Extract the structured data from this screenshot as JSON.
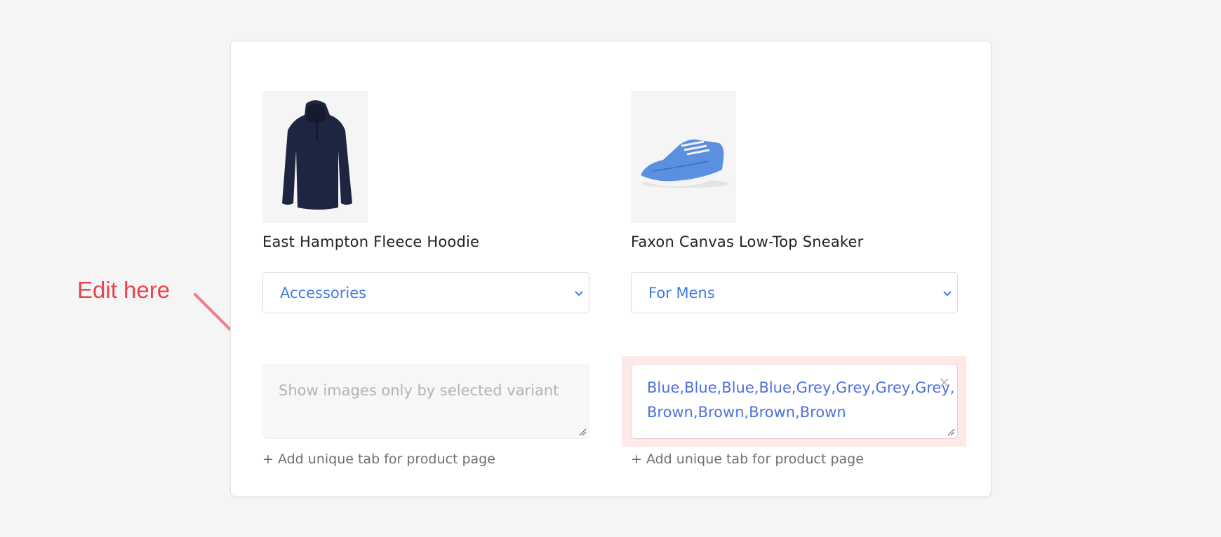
{
  "annotation": {
    "text": "Edit here",
    "color": "#e8424c"
  },
  "products": [
    {
      "name": "East Hampton Fleece Hoodie",
      "image_icon": "hoodie-image",
      "category_selected": "Accessories",
      "variant_field": {
        "value": "",
        "placeholder": "Show images only by selected variant"
      },
      "add_tab_label": "+ Add unique tab for product page"
    },
    {
      "name": "Faxon Canvas Low-Top Sneaker",
      "image_icon": "sneaker-image",
      "category_selected": "For Mens",
      "variant_field": {
        "value": "Blue,Blue,Blue,Blue,Grey,Grey,Grey,Grey,\nBrown,Brown,Brown,Brown",
        "placeholder": ""
      },
      "clear_icon": "×",
      "add_tab_label": "+ Add unique tab for product page"
    }
  ],
  "colors": {
    "accent": "#3f7be0",
    "variant_text": "#4f6fe0",
    "highlight": "#ffe8e8"
  }
}
